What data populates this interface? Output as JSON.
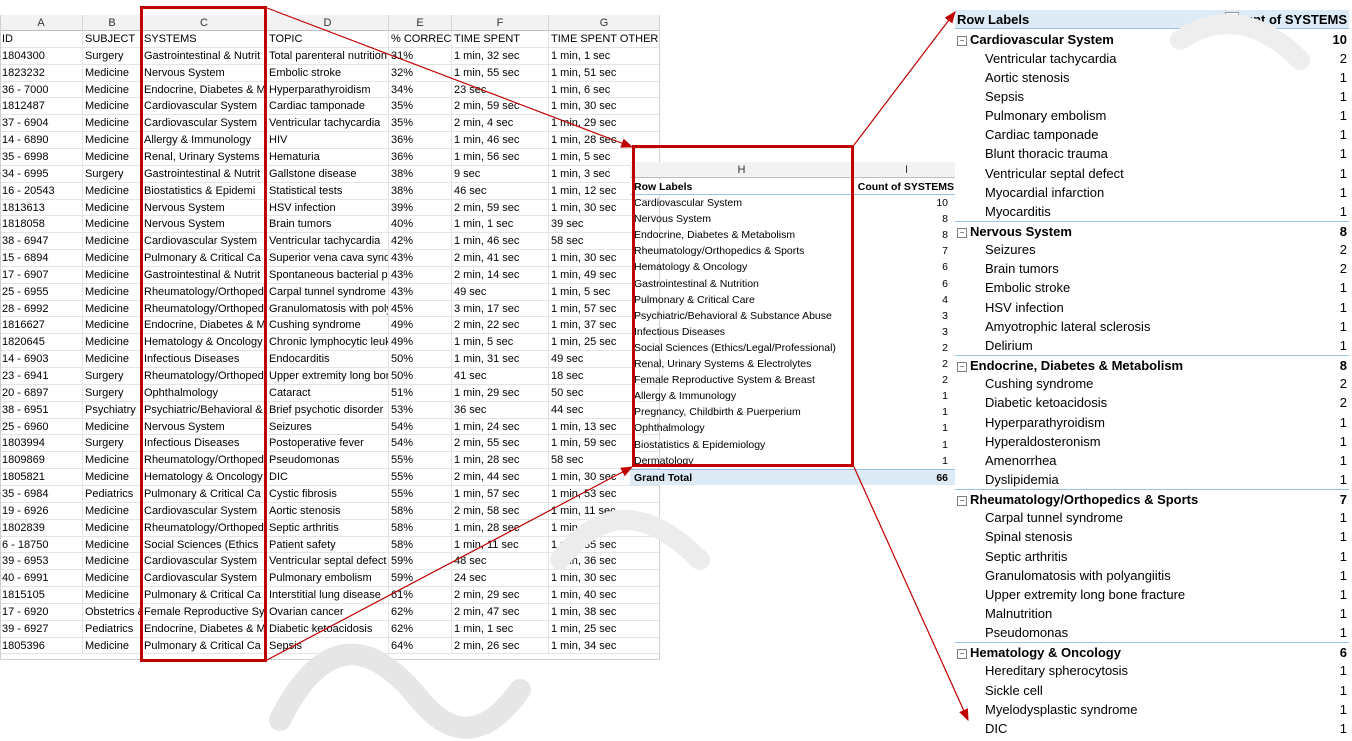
{
  "sheet": {
    "column_letters": [
      "A",
      "B",
      "C",
      "D",
      "E",
      "F",
      "G"
    ],
    "headers": [
      "ID",
      "SUBJECT",
      "SYSTEMS",
      "TOPIC",
      "% CORRECT",
      "TIME SPENT",
      "TIME SPENT OTHER"
    ],
    "rows": [
      [
        "1804300",
        "Surgery",
        "Gastrointestinal & Nutrit",
        "Total parenteral nutrition",
        "31%",
        "1 min, 32 sec",
        "1 min, 1 sec"
      ],
      [
        "1823232",
        "Medicine",
        "Nervous System",
        "Embolic stroke",
        "32%",
        "1 min, 55 sec",
        "1 min, 51 sec"
      ],
      [
        "36 - 7000",
        "Medicine",
        "Endocrine, Diabetes & M",
        "Hyperparathyroidism",
        "34%",
        "23 sec",
        "1 min, 6 sec"
      ],
      [
        "1812487",
        "Medicine",
        "Cardiovascular System",
        "Cardiac tamponade",
        "35%",
        "2 min, 59 sec",
        "1 min, 30 sec"
      ],
      [
        "37 - 6904",
        "Medicine",
        "Cardiovascular System",
        "Ventricular tachycardia",
        "35%",
        "2 min, 4 sec",
        "1 min, 29 sec"
      ],
      [
        "14 - 6890",
        "Medicine",
        "Allergy & Immunology",
        "HIV",
        "36%",
        "1 min, 46 sec",
        "1 min, 28 sec"
      ],
      [
        "35 - 6998",
        "Medicine",
        "Renal, Urinary Systems",
        "Hematuria",
        "36%",
        "1 min, 56 sec",
        "1 min, 5 sec"
      ],
      [
        "34 - 6995",
        "Surgery",
        "Gastrointestinal & Nutrit",
        "Gallstone disease",
        "38%",
        "9 sec",
        "1 min, 3 sec"
      ],
      [
        "16 - 20543",
        "Medicine",
        "Biostatistics & Epidemi",
        "Statistical tests",
        "38%",
        "46 sec",
        "1 min, 12 sec"
      ],
      [
        "1813613",
        "Medicine",
        "Nervous System",
        "HSV infection",
        "39%",
        "2 min, 59 sec",
        "1 min, 30 sec"
      ],
      [
        "1818058",
        "Medicine",
        "Nervous System",
        "Brain tumors",
        "40%",
        "1 min, 1 sec",
        "39 sec"
      ],
      [
        "38 - 6947",
        "Medicine",
        "Cardiovascular System",
        "Ventricular tachycardia",
        "42%",
        "1 min, 46 sec",
        "58 sec"
      ],
      [
        "15 - 6894",
        "Medicine",
        "Pulmonary & Critical Ca",
        "Superior vena cava synd",
        "43%",
        "2 min, 41 sec",
        "1 min, 30 sec"
      ],
      [
        "17 - 6907",
        "Medicine",
        "Gastrointestinal & Nutrit",
        "Spontaneous bacterial p",
        "43%",
        "2 min, 14 sec",
        "1 min, 49 sec"
      ],
      [
        "25 - 6955",
        "Medicine",
        "Rheumatology/Orthoped",
        "Carpal tunnel syndrome",
        "43%",
        "49 sec",
        "1 min, 5 sec"
      ],
      [
        "28 - 6992",
        "Medicine",
        "Rheumatology/Orthoped",
        "Granulomatosis with poly",
        "45%",
        "3 min, 17 sec",
        "1 min, 57 sec"
      ],
      [
        "1816627",
        "Medicine",
        "Endocrine, Diabetes & M",
        "Cushing syndrome",
        "49%",
        "2 min, 22 sec",
        "1 min, 37 sec"
      ],
      [
        "1820645",
        "Medicine",
        "Hematology & Oncology",
        "Chronic lymphocytic leuk",
        "49%",
        "1 min, 5 sec",
        "1 min, 25 sec"
      ],
      [
        "14 - 6903",
        "Medicine",
        "Infectious Diseases",
        "Endocarditis",
        "50%",
        "1 min, 31 sec",
        "49 sec"
      ],
      [
        "23 - 6941",
        "Surgery",
        "Rheumatology/Orthoped",
        "Upper extremity long bon",
        "50%",
        "41 sec",
        "18 sec"
      ],
      [
        "20 - 6897",
        "Surgery",
        "Ophthalmology",
        "Cataract",
        "51%",
        "1 min, 29 sec",
        "50 sec"
      ],
      [
        "38 - 6951",
        "Psychiatry",
        "Psychiatric/Behavioral &",
        "Brief psychotic disorder",
        "53%",
        "36 sec",
        "44 sec"
      ],
      [
        "25 - 6960",
        "Medicine",
        "Nervous System",
        "Seizures",
        "54%",
        "1 min, 24 sec",
        "1 min, 13 sec"
      ],
      [
        "1803994",
        "Surgery",
        "Infectious Diseases",
        "Postoperative fever",
        "54%",
        "2 min, 55 sec",
        "1 min, 59 sec"
      ],
      [
        "1809869",
        "Medicine",
        "Rheumatology/Orthoped",
        "Pseudomonas",
        "55%",
        "1 min, 28 sec",
        "58 sec"
      ],
      [
        "1805821",
        "Medicine",
        "Hematology & Oncology",
        "DIC",
        "55%",
        "2 min, 44 sec",
        "1 min, 30 sec"
      ],
      [
        "35 - 6984",
        "Pediatrics",
        "Pulmonary & Critical Ca",
        "Cystic fibrosis",
        "55%",
        "1 min, 57 sec",
        "1 min, 53 sec"
      ],
      [
        "19 - 6926",
        "Medicine",
        "Cardiovascular System",
        "Aortic stenosis",
        "58%",
        "2 min, 58 sec",
        "1 min, 11 sec"
      ],
      [
        "1802839",
        "Medicine",
        "Rheumatology/Orthoped",
        "Septic arthritis",
        "58%",
        "1 min, 28 sec",
        "1 min, 9 sec"
      ],
      [
        "6 - 18750",
        "Medicine",
        "Social Sciences (Ethics",
        "Patient safety",
        "58%",
        "1 min, 11 sec",
        "1 min, 35 sec"
      ],
      [
        "39 - 6953",
        "Medicine",
        "Cardiovascular System",
        "Ventricular septal defect",
        "59%",
        "48 sec",
        "1 min, 36 sec"
      ],
      [
        "40 - 6991",
        "Medicine",
        "Cardiovascular System",
        "Pulmonary embolism",
        "59%",
        "24 sec",
        "1 min, 30 sec"
      ],
      [
        "1815105",
        "Medicine",
        "Pulmonary & Critical Ca",
        "Interstitial lung disease",
        "61%",
        "2 min, 29 sec",
        "1 min, 40 sec"
      ],
      [
        "17 - 6920",
        "Obstetrics &",
        "Female Reproductive Sy",
        "Ovarian cancer",
        "62%",
        "2 min, 47 sec",
        "1 min, 38 sec"
      ],
      [
        "39 - 6927",
        "Pediatrics",
        "Endocrine, Diabetes & M",
        "Diabetic ketoacidosis",
        "62%",
        "1 min, 1 sec",
        "1 min, 25 sec"
      ],
      [
        "1805396",
        "Medicine",
        "Pulmonary & Critical Ca",
        "Sepsis",
        "64%",
        "2 min, 26 sec",
        "1 min, 34 sec"
      ]
    ]
  },
  "pivot_mid": {
    "column_letters": [
      "H",
      "I"
    ],
    "header_label": "Row Labels",
    "header_count": "Count of SYSTEMS",
    "rows": [
      [
        "Cardiovascular System",
        "10"
      ],
      [
        "Nervous System",
        "8"
      ],
      [
        "Endocrine, Diabetes & Metabolism",
        "8"
      ],
      [
        "Rheumatology/Orthopedics & Sports",
        "7"
      ],
      [
        "Hematology & Oncology",
        "6"
      ],
      [
        "Gastrointestinal & Nutrition",
        "6"
      ],
      [
        "Pulmonary & Critical Care",
        "4"
      ],
      [
        "Psychiatric/Behavioral & Substance Abuse",
        "3"
      ],
      [
        "Infectious Diseases",
        "3"
      ],
      [
        "Social Sciences (Ethics/Legal/Professional)",
        "2"
      ],
      [
        "Renal, Urinary Systems & Electrolytes",
        "2"
      ],
      [
        "Female Reproductive System & Breast",
        "2"
      ],
      [
        "Allergy & Immunology",
        "1"
      ],
      [
        "Pregnancy, Childbirth & Puerperium",
        "1"
      ],
      [
        "Ophthalmology",
        "1"
      ],
      [
        "Biostatistics & Epidemiology",
        "1"
      ],
      [
        "Dermatology",
        "1"
      ]
    ],
    "total_label": "Grand Total",
    "total_value": "66"
  },
  "pivot_right": {
    "header_label": "Row Labels",
    "header_count": "Count of SYSTEMS",
    "rows": [
      {
        "type": "group",
        "label": "Cardiovascular System",
        "count": "10"
      },
      {
        "type": "child",
        "label": "Ventricular tachycardia",
        "count": "2"
      },
      {
        "type": "child",
        "label": "Aortic stenosis",
        "count": "1"
      },
      {
        "type": "child",
        "label": "Sepsis",
        "count": "1"
      },
      {
        "type": "child",
        "label": "Pulmonary embolism",
        "count": "1"
      },
      {
        "type": "child",
        "label": "Cardiac tamponade",
        "count": "1"
      },
      {
        "type": "child",
        "label": "Blunt thoracic trauma",
        "count": "1"
      },
      {
        "type": "child",
        "label": "Ventricular septal defect",
        "count": "1"
      },
      {
        "type": "child",
        "label": "Myocardial infarction",
        "count": "1"
      },
      {
        "type": "child",
        "label": "Myocarditis",
        "count": "1"
      },
      {
        "type": "group",
        "label": "Nervous System",
        "count": "8"
      },
      {
        "type": "child",
        "label": "Seizures",
        "count": "2"
      },
      {
        "type": "child",
        "label": "Brain tumors",
        "count": "2"
      },
      {
        "type": "child",
        "label": "Embolic stroke",
        "count": "1"
      },
      {
        "type": "child",
        "label": "HSV infection",
        "count": "1"
      },
      {
        "type": "child",
        "label": "Amyotrophic lateral sclerosis",
        "count": "1"
      },
      {
        "type": "child",
        "label": "Delirium",
        "count": "1"
      },
      {
        "type": "group",
        "label": "Endocrine, Diabetes & Metabolism",
        "count": "8"
      },
      {
        "type": "child",
        "label": "Cushing syndrome",
        "count": "2"
      },
      {
        "type": "child",
        "label": "Diabetic ketoacidosis",
        "count": "2"
      },
      {
        "type": "child",
        "label": "Hyperparathyroidism",
        "count": "1"
      },
      {
        "type": "child",
        "label": "Hyperaldosteronism",
        "count": "1"
      },
      {
        "type": "child",
        "label": "Amenorrhea",
        "count": "1"
      },
      {
        "type": "child",
        "label": "Dyslipidemia",
        "count": "1"
      },
      {
        "type": "group",
        "label": "Rheumatology/Orthopedics & Sports",
        "count": "7"
      },
      {
        "type": "child",
        "label": "Carpal tunnel syndrome",
        "count": "1"
      },
      {
        "type": "child",
        "label": "Spinal stenosis",
        "count": "1"
      },
      {
        "type": "child",
        "label": "Septic arthritis",
        "count": "1"
      },
      {
        "type": "child",
        "label": "Granulomatosis with polyangiitis",
        "count": "1"
      },
      {
        "type": "child",
        "label": "Upper extremity long bone fracture",
        "count": "1"
      },
      {
        "type": "child",
        "label": "Malnutrition",
        "count": "1"
      },
      {
        "type": "child",
        "label": "Pseudomonas",
        "count": "1"
      },
      {
        "type": "group",
        "label": "Hematology & Oncology",
        "count": "6"
      },
      {
        "type": "child",
        "label": "Hereditary spherocytosis",
        "count": "1"
      },
      {
        "type": "child",
        "label": "Sickle cell",
        "count": "1"
      },
      {
        "type": "child",
        "label": "Myelodysplastic syndrome",
        "count": "1"
      },
      {
        "type": "child",
        "label": "DIC",
        "count": "1"
      }
    ]
  },
  "colors": {
    "highlight": "#c00000",
    "pivot_header_fill": "#ddebf7",
    "pivot_border": "#9bc2e6",
    "col_header_fill": "#f2f2f2"
  }
}
